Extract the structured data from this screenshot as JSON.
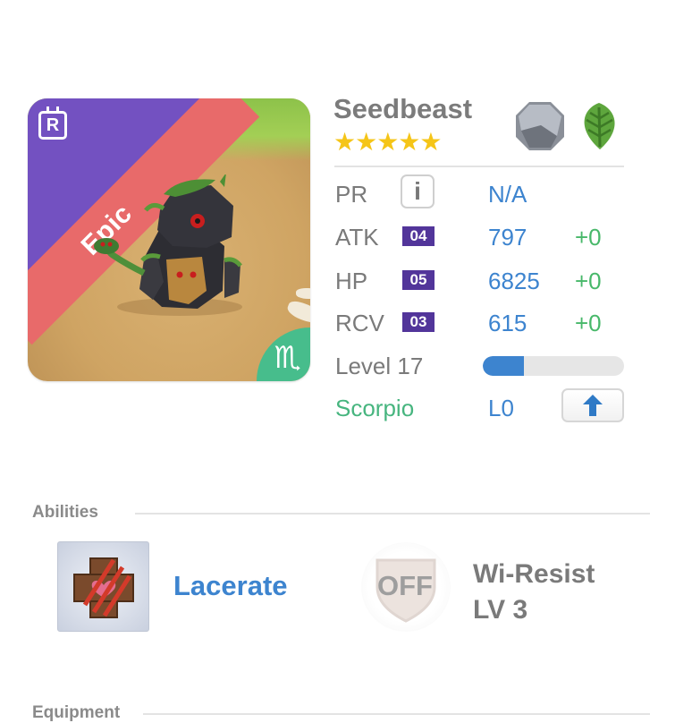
{
  "monster": {
    "name": "Seedbeast",
    "stars": "★★★★★",
    "rarity": "Epic",
    "rank_badge": "R",
    "zodiac_symbol": "♏",
    "element_icons": [
      "stone-icon",
      "leaf-icon"
    ]
  },
  "stats": {
    "pr": {
      "label": "PR",
      "value": "N/A"
    },
    "atk": {
      "label": "ATK",
      "level": "04",
      "value": "797",
      "bonus": "+0"
    },
    "hp": {
      "label": "HP",
      "level": "05",
      "value": "6825",
      "bonus": "+0"
    },
    "rcv": {
      "label": "RCV",
      "level": "03",
      "value": "615",
      "bonus": "+0"
    }
  },
  "level": {
    "label": "Level 17",
    "progress": 0.29
  },
  "zodiac": {
    "label": "Scorpio",
    "value": "L0"
  },
  "abilities": {
    "title": "Abilities",
    "active": {
      "name": "Lacerate"
    },
    "passive": {
      "status": "OFF",
      "name_line1": "Wi-Resist",
      "name_line2": "LV 3"
    }
  },
  "equipment": {
    "title": "Equipment"
  },
  "colors": {
    "accent_blue": "#3d84cf",
    "bonus_green": "#48b86a",
    "epic_red": "#e86a6a",
    "rank_purple": "#7351c1",
    "zodiac_green": "#47bd8c"
  }
}
